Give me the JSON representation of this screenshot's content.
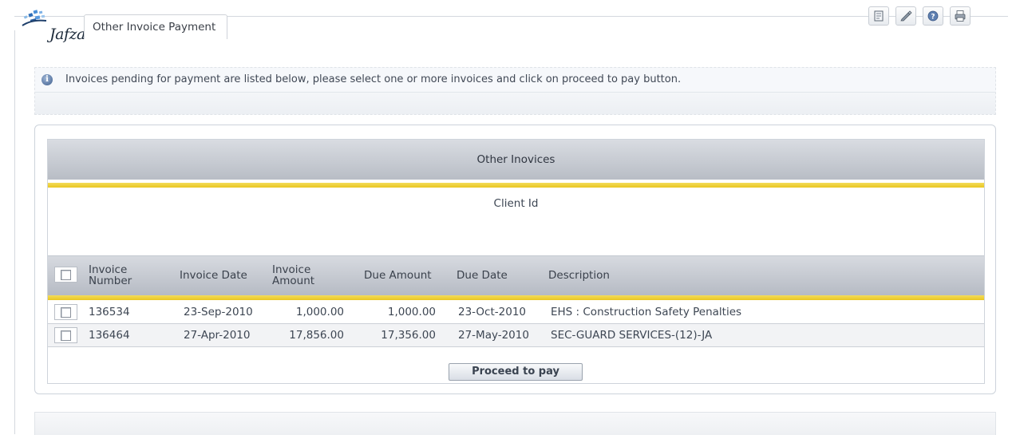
{
  "header": {
    "logo_text": "Jafza",
    "page_title": "Other Invoice Payment",
    "tools": [
      {
        "icon": "document-icon"
      },
      {
        "icon": "edit-icon"
      },
      {
        "icon": "help-icon"
      },
      {
        "icon": "printer-icon"
      }
    ]
  },
  "info": {
    "message": "Invoices pending for payment are listed below, please select one or more invoices and click on proceed to pay button."
  },
  "section": {
    "title": "Other Inovices",
    "client_label": "Client Id"
  },
  "table": {
    "columns": {
      "invoice_number": [
        "Invoice",
        "Number"
      ],
      "invoice_date": "Invoice Date",
      "invoice_amount": [
        "Invoice",
        "Amount"
      ],
      "due_amount": "Due Amount",
      "due_date": "Due Date",
      "description": "Description"
    },
    "rows": [
      {
        "number": "136534",
        "date": "23-Sep-2010",
        "amount": "1,000.00",
        "due_amount": "1,000.00",
        "due_date": "23-Oct-2010",
        "description": "EHS : Construction Safety Penalties"
      },
      {
        "number": "136464",
        "date": "27-Apr-2010",
        "amount": "17,856.00",
        "due_amount": "17,356.00",
        "due_date": "27-May-2010",
        "description": "SEC-GUARD SERVICES-(12)-JA"
      }
    ]
  },
  "actions": {
    "proceed_label": "Proceed to pay"
  },
  "colors": {
    "accent_yellow": "#e9c622",
    "header_gray": "#b8bdc5",
    "text": "#3d4653"
  }
}
